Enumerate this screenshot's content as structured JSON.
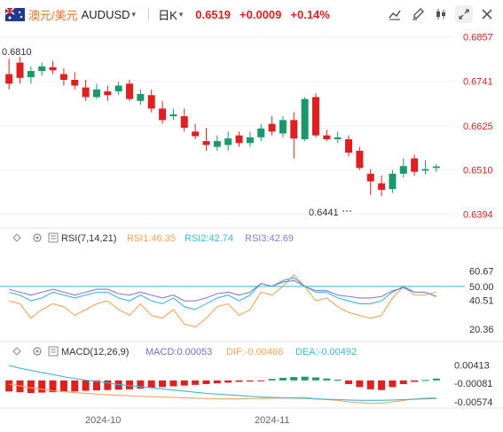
{
  "header": {
    "pair_cn": "澳元/美元",
    "symbol": "AUDUSD",
    "caret": "▾",
    "period": "日K",
    "price": "0.6519",
    "change": "+0.0009",
    "change_pct": "+0.14%"
  },
  "toolbar": [
    {
      "name": "draw-line-icon",
      "selected": false
    },
    {
      "name": "brush-icon",
      "selected": false
    },
    {
      "name": "candle-type-icon",
      "selected": false
    },
    {
      "name": "crosshair-icon",
      "selected": false
    },
    {
      "name": "settings-icon",
      "selected": false
    }
  ],
  "colors": {
    "up": "#1a9a6c",
    "down": "#e02020",
    "rsi1": "#f4a256",
    "rsi2": "#3bb8d8",
    "rsi3": "#8b7bd8",
    "macd_line": "#f4a256",
    "dea_line": "#3bb8d8",
    "level_line": "#3bb8d8"
  },
  "chart_data": [
    {
      "type": "candlestick",
      "price_axis": [
        "0.6857",
        "0.6741",
        "0.6625",
        "0.6510",
        "0.6394"
      ],
      "ylim": [
        0.637,
        0.687
      ],
      "annotations": {
        "high": "0.6810",
        "low": "0.6441"
      },
      "candles": [
        {
          "o": 0.676,
          "h": 0.68,
          "l": 0.672,
          "c": 0.6735
        },
        {
          "o": 0.679,
          "h": 0.6805,
          "l": 0.6735,
          "c": 0.675
        },
        {
          "o": 0.6752,
          "h": 0.678,
          "l": 0.6735,
          "c": 0.6768
        },
        {
          "o": 0.6768,
          "h": 0.679,
          "l": 0.6755,
          "c": 0.678
        },
        {
          "o": 0.6778,
          "h": 0.6795,
          "l": 0.676,
          "c": 0.677
        },
        {
          "o": 0.676,
          "h": 0.6775,
          "l": 0.673,
          "c": 0.6745
        },
        {
          "o": 0.6745,
          "h": 0.6765,
          "l": 0.672,
          "c": 0.673
        },
        {
          "o": 0.6725,
          "h": 0.6745,
          "l": 0.669,
          "c": 0.67
        },
        {
          "o": 0.67,
          "h": 0.6735,
          "l": 0.6695,
          "c": 0.672
        },
        {
          "o": 0.6715,
          "h": 0.673,
          "l": 0.669,
          "c": 0.6705
        },
        {
          "o": 0.6715,
          "h": 0.674,
          "l": 0.6705,
          "c": 0.673
        },
        {
          "o": 0.6735,
          "h": 0.6745,
          "l": 0.669,
          "c": 0.6695
        },
        {
          "o": 0.669,
          "h": 0.672,
          "l": 0.668,
          "c": 0.6708
        },
        {
          "o": 0.6705,
          "h": 0.672,
          "l": 0.666,
          "c": 0.667
        },
        {
          "o": 0.667,
          "h": 0.669,
          "l": 0.663,
          "c": 0.664
        },
        {
          "o": 0.665,
          "h": 0.667,
          "l": 0.664,
          "c": 0.6655
        },
        {
          "o": 0.665,
          "h": 0.667,
          "l": 0.661,
          "c": 0.662
        },
        {
          "o": 0.661,
          "h": 0.663,
          "l": 0.659,
          "c": 0.6598
        },
        {
          "o": 0.6585,
          "h": 0.662,
          "l": 0.656,
          "c": 0.6575
        },
        {
          "o": 0.657,
          "h": 0.66,
          "l": 0.656,
          "c": 0.6585
        },
        {
          "o": 0.6575,
          "h": 0.661,
          "l": 0.656,
          "c": 0.6592
        },
        {
          "o": 0.66,
          "h": 0.661,
          "l": 0.657,
          "c": 0.658
        },
        {
          "o": 0.658,
          "h": 0.661,
          "l": 0.657,
          "c": 0.6595
        },
        {
          "o": 0.6595,
          "h": 0.663,
          "l": 0.6585,
          "c": 0.6618
        },
        {
          "o": 0.663,
          "h": 0.665,
          "l": 0.66,
          "c": 0.661
        },
        {
          "o": 0.6605,
          "h": 0.665,
          "l": 0.6595,
          "c": 0.664
        },
        {
          "o": 0.664,
          "h": 0.666,
          "l": 0.654,
          "c": 0.6592
        },
        {
          "o": 0.659,
          "h": 0.67,
          "l": 0.6585,
          "c": 0.6695
        },
        {
          "o": 0.67,
          "h": 0.671,
          "l": 0.6595,
          "c": 0.66
        },
        {
          "o": 0.66,
          "h": 0.6615,
          "l": 0.6585,
          "c": 0.659
        },
        {
          "o": 0.659,
          "h": 0.661,
          "l": 0.658,
          "c": 0.6595
        },
        {
          "o": 0.659,
          "h": 0.66,
          "l": 0.6545,
          "c": 0.6555
        },
        {
          "o": 0.656,
          "h": 0.657,
          "l": 0.651,
          "c": 0.6515
        },
        {
          "o": 0.65,
          "h": 0.6512,
          "l": 0.6445,
          "c": 0.648
        },
        {
          "o": 0.6475,
          "h": 0.6495,
          "l": 0.6441,
          "c": 0.6458
        },
        {
          "o": 0.646,
          "h": 0.651,
          "l": 0.645,
          "c": 0.65
        },
        {
          "o": 0.65,
          "h": 0.654,
          "l": 0.649,
          "c": 0.652
        },
        {
          "o": 0.654,
          "h": 0.655,
          "l": 0.6495,
          "c": 0.6505
        },
        {
          "o": 0.6508,
          "h": 0.6535,
          "l": 0.6498,
          "c": 0.6512
        },
        {
          "o": 0.6515,
          "h": 0.6525,
          "l": 0.6505,
          "c": 0.6519
        }
      ]
    },
    {
      "type": "line",
      "name": "RSI",
      "title": "RSI(7,14,21)",
      "values_text": {
        "rsi1": "RSI1:46.35",
        "rsi2": "RSI2:42.74",
        "rsi3": "RSI3:42.69"
      },
      "axis": [
        "60.67",
        "50.00",
        "40.51",
        "20.36"
      ],
      "ylim": [
        15,
        75
      ],
      "level": 50.0,
      "series": [
        {
          "name": "RSI1",
          "values": [
            40,
            38,
            28,
            34,
            38,
            36,
            30,
            34,
            38,
            40,
            34,
            30,
            38,
            30,
            28,
            34,
            24,
            22,
            28,
            36,
            38,
            30,
            34,
            46,
            44,
            50,
            58,
            50,
            40,
            42,
            36,
            32,
            30,
            28,
            30,
            42,
            50,
            44,
            44,
            46
          ]
        },
        {
          "name": "RSI2",
          "values": [
            46,
            44,
            40,
            42,
            46,
            44,
            42,
            44,
            46,
            46,
            42,
            40,
            44,
            40,
            38,
            42,
            36,
            34,
            38,
            42,
            44,
            40,
            44,
            52,
            50,
            54,
            56,
            50,
            46,
            46,
            42,
            40,
            38,
            38,
            40,
            46,
            50,
            46,
            46,
            43
          ]
        },
        {
          "name": "RSI3",
          "values": [
            48,
            46,
            44,
            46,
            48,
            46,
            44,
            46,
            48,
            48,
            45,
            44,
            46,
            44,
            42,
            44,
            40,
            40,
            42,
            45,
            46,
            44,
            46,
            52,
            50,
            53,
            54,
            50,
            47,
            47,
            44,
            43,
            42,
            42,
            43,
            47,
            49,
            46,
            46,
            43
          ]
        }
      ]
    },
    {
      "type": "bar",
      "name": "MACD",
      "title": "MACD(12,26,9)",
      "values_text": {
        "macd": "MACD:0.00053",
        "dif": "DIF:-0.00466",
        "dea": "DEA:-0.00492"
      },
      "axis": [
        "0.00413",
        "-0.00081",
        "-0.00574"
      ],
      "ylim": [
        -0.007,
        0.005
      ],
      "histogram": [
        -0.003,
        -0.0032,
        -0.0034,
        -0.0033,
        -0.0032,
        -0.0031,
        -0.003,
        -0.0028,
        -0.0027,
        -0.0026,
        -0.0025,
        -0.0024,
        -0.0022,
        -0.002,
        -0.0018,
        -0.0016,
        -0.0014,
        -0.0012,
        -0.001,
        -0.0008,
        -0.0006,
        -0.0004,
        -0.0003,
        -0.0001,
        0.0004,
        0.0007,
        0.0009,
        0.001,
        0.0008,
        0.0005,
        0.0002,
        -0.001,
        -0.0018,
        -0.0024,
        -0.0026,
        -0.0018,
        -0.001,
        -0.0004,
        0.0001,
        0.0005
      ],
      "series": [
        {
          "name": "DIF",
          "values": [
            -0.001,
            -0.0015,
            -0.002,
            -0.0024,
            -0.0028,
            -0.003,
            -0.0033,
            -0.0035,
            -0.0037,
            -0.0039,
            -0.004,
            -0.0042,
            -0.0043,
            -0.0044,
            -0.0045,
            -0.0046,
            -0.0047,
            -0.0048,
            -0.0049,
            -0.005,
            -0.005,
            -0.005,
            -0.0049,
            -0.0049,
            -0.0048,
            -0.0048,
            -0.0047,
            -0.0046,
            -0.005,
            -0.0052,
            -0.0054,
            -0.0058,
            -0.006,
            -0.0062,
            -0.0062,
            -0.0058,
            -0.0054,
            -0.005,
            -0.0048,
            -0.0047
          ]
        },
        {
          "name": "DEA",
          "values": [
            0.004,
            0.0033,
            0.0027,
            0.0021,
            0.0016,
            0.001,
            0.0005,
            0.0001,
            -0.0003,
            -0.0007,
            -0.0011,
            -0.0014,
            -0.0017,
            -0.002,
            -0.0023,
            -0.0026,
            -0.0029,
            -0.0032,
            -0.0035,
            -0.0037,
            -0.0039,
            -0.0041,
            -0.0043,
            -0.0045,
            -0.0046,
            -0.0047,
            -0.0048,
            -0.0049,
            -0.005,
            -0.0051,
            -0.0052,
            -0.0053,
            -0.0054,
            -0.0054,
            -0.0054,
            -0.0053,
            -0.0052,
            -0.0051,
            -0.005,
            -0.0049
          ]
        }
      ]
    }
  ],
  "x_axis": [
    "2024-10",
    "2024-11"
  ]
}
